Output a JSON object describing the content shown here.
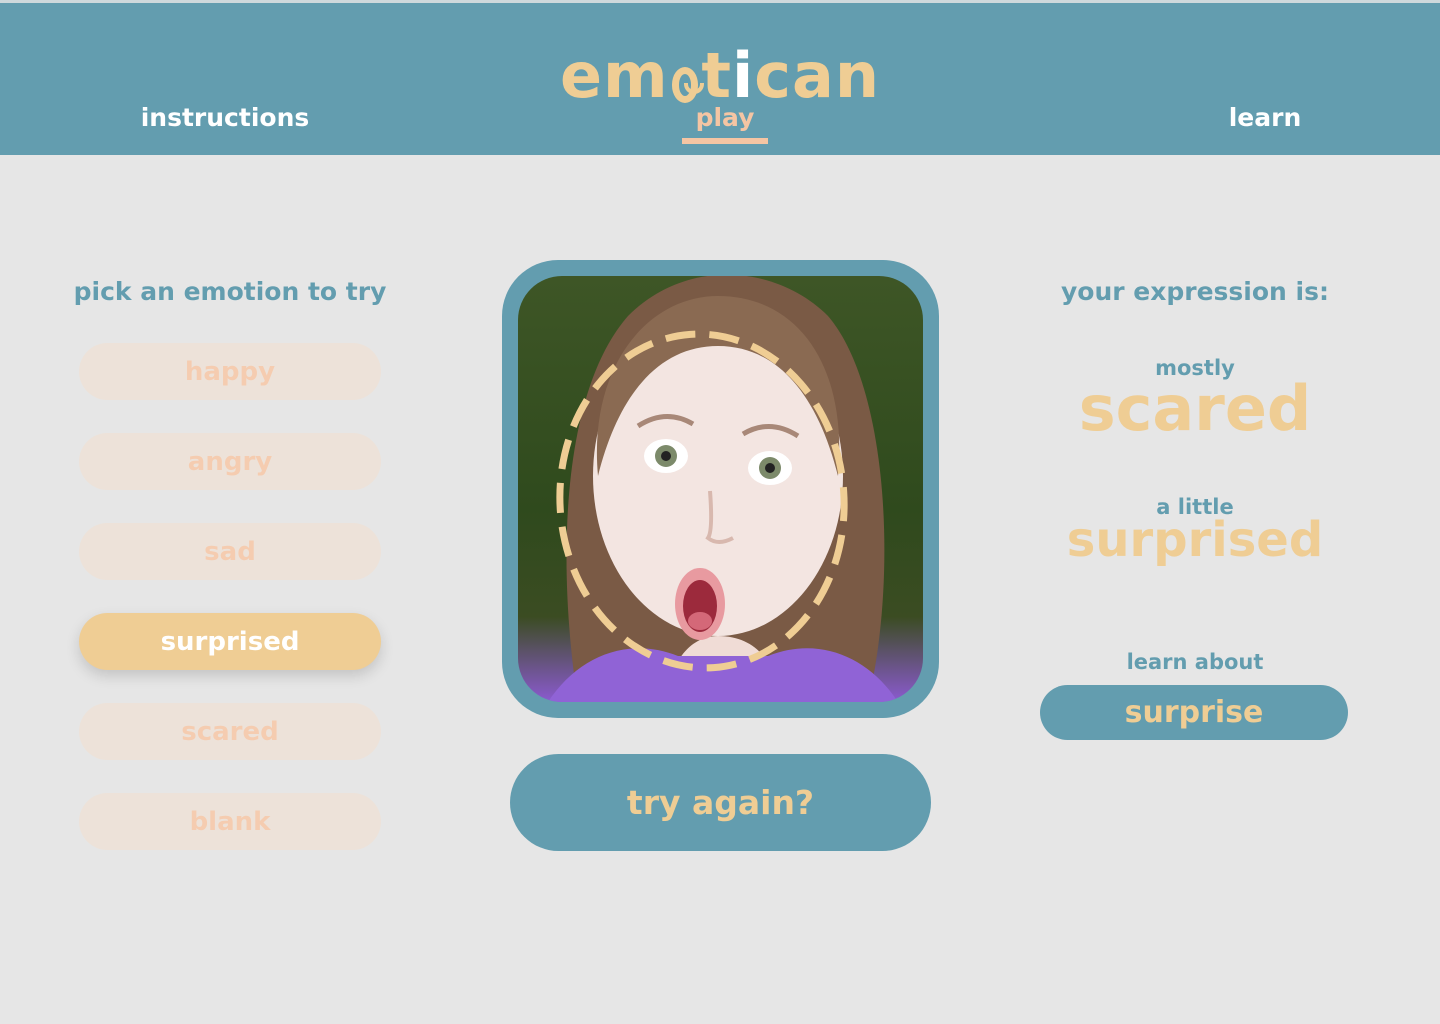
{
  "header": {
    "logo": {
      "part1": "em",
      "part2": "t",
      "part3": "i",
      "part4": "can"
    },
    "nav": {
      "instructions": "instructions",
      "play": "play",
      "learn": "learn"
    },
    "active_nav": "play"
  },
  "left_panel": {
    "title": "pick an emotion to try",
    "emotions": [
      "happy",
      "angry",
      "sad",
      "surprised",
      "scared",
      "blank"
    ],
    "selected": "surprised"
  },
  "center": {
    "try_again_label": "try again?"
  },
  "right_panel": {
    "title": "your expression is:",
    "primary_qualifier": "mostly",
    "primary_emotion": "scared",
    "secondary_qualifier": "a little",
    "secondary_emotion": "surprised",
    "learn_about_label": "learn about",
    "learn_button_label": "surprise"
  },
  "colors": {
    "header_teal": "#639daf",
    "accent_gold": "#efcd94",
    "accent_peach": "#f5c5a3",
    "background": "#e6e6e6"
  }
}
